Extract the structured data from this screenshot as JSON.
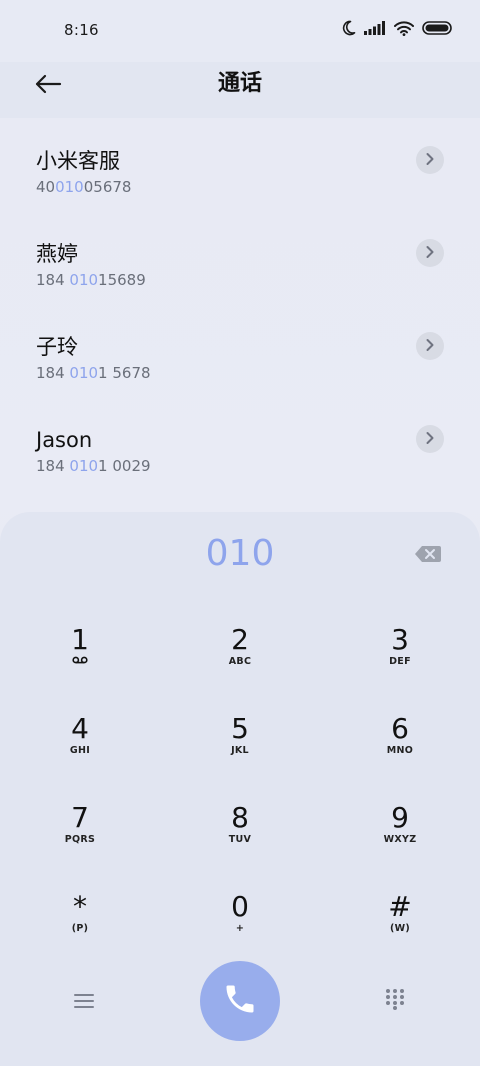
{
  "status_bar": {
    "time": "8:16"
  },
  "header": {
    "title": "通话"
  },
  "contacts": [
    {
      "name": "小米客服",
      "num_before": "40",
      "num_match": "010",
      "num_after": "05678"
    },
    {
      "name": "燕婷",
      "num_before": "184 ",
      "num_match": "010",
      "num_after": "15689"
    },
    {
      "name": "子玲",
      "num_before": "184 ",
      "num_match": "010",
      "num_after": "1 5678"
    },
    {
      "name": "Jason",
      "num_before": "184 ",
      "num_match": "010",
      "num_after": "1 0029"
    }
  ],
  "dialer": {
    "input": "010",
    "keys": [
      {
        "digit": "1",
        "letters": ""
      },
      {
        "digit": "2",
        "letters": "ABC"
      },
      {
        "digit": "3",
        "letters": "DEF"
      },
      {
        "digit": "4",
        "letters": "GHI"
      },
      {
        "digit": "5",
        "letters": "JKL"
      },
      {
        "digit": "6",
        "letters": "MNO"
      },
      {
        "digit": "7",
        "letters": "PQRS"
      },
      {
        "digit": "8",
        "letters": "TUV"
      },
      {
        "digit": "9",
        "letters": "WXYZ"
      },
      {
        "digit": "*",
        "letters": "(P)"
      },
      {
        "digit": "0",
        "letters": "+"
      },
      {
        "digit": "#",
        "letters": "(W)"
      }
    ]
  },
  "colors": {
    "accent": "#8ea4ec",
    "call_button": "#98adec",
    "sheet": "#e1e5f1",
    "header": "#e2e6f1"
  },
  "icons": {
    "status": [
      "moon-icon",
      "signal-icon",
      "wifi-icon",
      "battery-icon"
    ],
    "back": "arrow-left-icon",
    "chevron": "chevron-right-icon",
    "delete": "backspace-icon",
    "voicemail": "voicemail-icon",
    "menu": "menu-icon",
    "call": "phone-icon",
    "keypad": "keypad-icon"
  }
}
